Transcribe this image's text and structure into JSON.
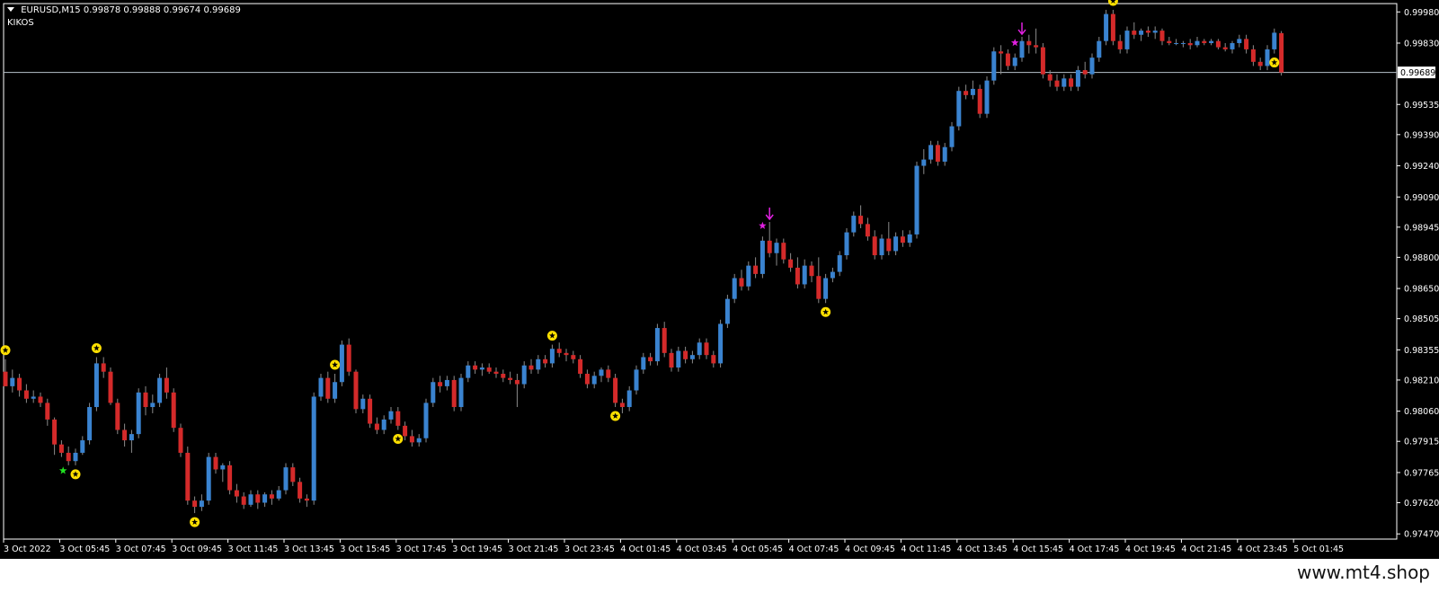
{
  "header": {
    "symbol": "EURUSD,M15",
    "ohlc": "0.99878 0.99888 0.99674 0.99689",
    "indicator": "KIKOS"
  },
  "watermark": "www.mt4.shop",
  "price_tag": "0.99689",
  "colors": {
    "background": "#000000",
    "bull": "#3a83d0",
    "bear": "#d42a2a",
    "grid_axis": "#ffffff",
    "star_signal": "#ffe000",
    "magenta_signal": "#e020e0",
    "green_signal": "#20e020",
    "price_line": "#b8c2cc"
  },
  "chart_data": {
    "type": "candlestick",
    "symbol": "EURUSD",
    "timeframe": "M15",
    "y_ticks": [
      0.9998,
      0.9983,
      0.99689,
      0.99535,
      0.9939,
      0.9924,
      0.9909,
      0.98945,
      0.988,
      0.9865,
      0.98505,
      0.98355,
      0.9821,
      0.9806,
      0.97915,
      0.97765,
      0.9762,
      0.9747
    ],
    "y_tick_labels": [
      "0.99980",
      "0.99830",
      "0.99689",
      "0.99535",
      "0.99390",
      "0.99240",
      "0.99090",
      "0.98945",
      "0.98800",
      "0.98650",
      "0.98505",
      "0.98355",
      "0.98210",
      "0.98060",
      "0.97915",
      "0.97765",
      "0.97620",
      "0.97470"
    ],
    "ylim": [
      0.97445,
      1.0002
    ],
    "x_labels": [
      "3 Oct 2022",
      "3 Oct 05:45",
      "3 Oct 07:45",
      "3 Oct 09:45",
      "3 Oct 11:45",
      "3 Oct 13:45",
      "3 Oct 15:45",
      "3 Oct 17:45",
      "3 Oct 19:45",
      "3 Oct 21:45",
      "3 Oct 23:45",
      "4 Oct 01:45",
      "4 Oct 03:45",
      "4 Oct 05:45",
      "4 Oct 07:45",
      "4 Oct 09:45",
      "4 Oct 11:45",
      "4 Oct 13:45",
      "4 Oct 15:45",
      "4 Oct 17:45",
      "4 Oct 19:45",
      "4 Oct 21:45",
      "4 Oct 23:45",
      "5 Oct 01:45"
    ],
    "candles_per_label": 8,
    "current_price": 0.99689,
    "candles": [
      [
        0.9825,
        0.9831,
        0.9818,
        0.9818
      ],
      [
        0.9818,
        0.9826,
        0.9815,
        0.9822
      ],
      [
        0.9822,
        0.9824,
        0.9813,
        0.9816
      ],
      [
        0.9816,
        0.9819,
        0.981,
        0.9812
      ],
      [
        0.9812,
        0.9816,
        0.981,
        0.9813
      ],
      [
        0.9813,
        0.9815,
        0.9808,
        0.981
      ],
      [
        0.981,
        0.9812,
        0.9799,
        0.9802
      ],
      [
        0.9802,
        0.9803,
        0.9785,
        0.979
      ],
      [
        0.979,
        0.9792,
        0.9784,
        0.9786
      ],
      [
        0.9786,
        0.9789,
        0.978,
        0.9782
      ],
      [
        0.9782,
        0.9788,
        0.978,
        0.9786
      ],
      [
        0.9786,
        0.9794,
        0.9785,
        0.9792
      ],
      [
        0.9792,
        0.981,
        0.979,
        0.9808
      ],
      [
        0.9808,
        0.9832,
        0.9806,
        0.9829
      ],
      [
        0.9829,
        0.9832,
        0.9822,
        0.9825
      ],
      [
        0.9825,
        0.9827,
        0.9809,
        0.981
      ],
      [
        0.981,
        0.9812,
        0.9795,
        0.9797
      ],
      [
        0.9797,
        0.98,
        0.9789,
        0.9792
      ],
      [
        0.9792,
        0.9797,
        0.9786,
        0.9795
      ],
      [
        0.9795,
        0.9817,
        0.9793,
        0.9815
      ],
      [
        0.9815,
        0.9818,
        0.9804,
        0.9808
      ],
      [
        0.9808,
        0.9814,
        0.9805,
        0.981
      ],
      [
        0.981,
        0.9824,
        0.9808,
        0.9822
      ],
      [
        0.9822,
        0.9827,
        0.9812,
        0.9815
      ],
      [
        0.9815,
        0.9817,
        0.9796,
        0.9798
      ],
      [
        0.9798,
        0.98,
        0.9784,
        0.9786
      ],
      [
        0.9786,
        0.9789,
        0.9761,
        0.9763
      ],
      [
        0.9763,
        0.9765,
        0.9757,
        0.976
      ],
      [
        0.976,
        0.9766,
        0.9758,
        0.9763
      ],
      [
        0.9763,
        0.9786,
        0.9761,
        0.9784
      ],
      [
        0.9784,
        0.9786,
        0.9776,
        0.9778
      ],
      [
        0.9778,
        0.9781,
        0.9772,
        0.978
      ],
      [
        0.978,
        0.9782,
        0.9766,
        0.9768
      ],
      [
        0.9768,
        0.9771,
        0.9762,
        0.9765
      ],
      [
        0.9765,
        0.9767,
        0.9759,
        0.9761
      ],
      [
        0.9761,
        0.9768,
        0.976,
        0.9766
      ],
      [
        0.9766,
        0.9768,
        0.9759,
        0.9762
      ],
      [
        0.9762,
        0.9767,
        0.976,
        0.9766
      ],
      [
        0.9766,
        0.9768,
        0.9761,
        0.9764
      ],
      [
        0.9764,
        0.977,
        0.9763,
        0.9768
      ],
      [
        0.9768,
        0.9781,
        0.9766,
        0.9779
      ],
      [
        0.9779,
        0.9781,
        0.977,
        0.9772
      ],
      [
        0.9772,
        0.9774,
        0.9762,
        0.9764
      ],
      [
        0.9764,
        0.9766,
        0.976,
        0.9763
      ],
      [
        0.9763,
        0.9815,
        0.9761,
        0.9813
      ],
      [
        0.9813,
        0.9824,
        0.9811,
        0.9822
      ],
      [
        0.9822,
        0.9825,
        0.981,
        0.9812
      ],
      [
        0.9812,
        0.9824,
        0.981,
        0.982
      ],
      [
        0.982,
        0.984,
        0.9818,
        0.9838
      ],
      [
        0.9838,
        0.9841,
        0.9823,
        0.9825
      ],
      [
        0.9825,
        0.9826,
        0.9805,
        0.9807
      ],
      [
        0.9807,
        0.9814,
        0.9805,
        0.9812
      ],
      [
        0.9812,
        0.9814,
        0.9798,
        0.98
      ],
      [
        0.98,
        0.9803,
        0.9795,
        0.9797
      ],
      [
        0.9797,
        0.9804,
        0.9795,
        0.9802
      ],
      [
        0.9802,
        0.9808,
        0.98,
        0.9806
      ],
      [
        0.9806,
        0.9808,
        0.9797,
        0.9799
      ],
      [
        0.9799,
        0.9801,
        0.9792,
        0.9794
      ],
      [
        0.9794,
        0.9797,
        0.9789,
        0.9791
      ],
      [
        0.9791,
        0.9795,
        0.9789,
        0.9793
      ],
      [
        0.9793,
        0.9812,
        0.9791,
        0.981
      ],
      [
        0.981,
        0.9822,
        0.9808,
        0.982
      ],
      [
        0.982,
        0.9823,
        0.9815,
        0.9818
      ],
      [
        0.9818,
        0.9823,
        0.9816,
        0.9821
      ],
      [
        0.9821,
        0.9823,
        0.9806,
        0.9808
      ],
      [
        0.9808,
        0.9824,
        0.9806,
        0.9822
      ],
      [
        0.9822,
        0.983,
        0.982,
        0.9828
      ],
      [
        0.9828,
        0.983,
        0.9824,
        0.9826
      ],
      [
        0.9826,
        0.9829,
        0.9823,
        0.9827
      ],
      [
        0.9827,
        0.9829,
        0.9824,
        0.9825
      ],
      [
        0.9825,
        0.9827,
        0.9822,
        0.9824
      ],
      [
        0.9824,
        0.9826,
        0.982,
        0.9822
      ],
      [
        0.9822,
        0.9825,
        0.9819,
        0.9821
      ],
      [
        0.9821,
        0.9824,
        0.9808,
        0.9819
      ],
      [
        0.9819,
        0.983,
        0.9817,
        0.9828
      ],
      [
        0.9828,
        0.9831,
        0.9824,
        0.9826
      ],
      [
        0.9826,
        0.9833,
        0.9824,
        0.9831
      ],
      [
        0.9831,
        0.9833,
        0.9827,
        0.9829
      ],
      [
        0.9829,
        0.9838,
        0.9827,
        0.9836
      ],
      [
        0.9836,
        0.9839,
        0.9832,
        0.9834
      ],
      [
        0.9834,
        0.9836,
        0.983,
        0.9833
      ],
      [
        0.9833,
        0.9835,
        0.9829,
        0.9831
      ],
      [
        0.9831,
        0.9833,
        0.9822,
        0.9824
      ],
      [
        0.9824,
        0.9826,
        0.9817,
        0.9819
      ],
      [
        0.9819,
        0.9825,
        0.9817,
        0.9823
      ],
      [
        0.9823,
        0.9827,
        0.982,
        0.9826
      ],
      [
        0.9826,
        0.9828,
        0.982,
        0.9822
      ],
      [
        0.9822,
        0.9824,
        0.9808,
        0.981
      ],
      [
        0.981,
        0.9812,
        0.9805,
        0.9808
      ],
      [
        0.9808,
        0.9818,
        0.9806,
        0.9816
      ],
      [
        0.9816,
        0.9828,
        0.9814,
        0.9826
      ],
      [
        0.9826,
        0.9834,
        0.9824,
        0.9832
      ],
      [
        0.9832,
        0.9834,
        0.9828,
        0.983
      ],
      [
        0.983,
        0.9848,
        0.9828,
        0.9846
      ],
      [
        0.9846,
        0.9849,
        0.9832,
        0.9834
      ],
      [
        0.9834,
        0.9836,
        0.9825,
        0.9827
      ],
      [
        0.9827,
        0.9837,
        0.9825,
        0.9835
      ],
      [
        0.9835,
        0.9837,
        0.9829,
        0.9831
      ],
      [
        0.9831,
        0.9835,
        0.9829,
        0.9833
      ],
      [
        0.9833,
        0.9841,
        0.9831,
        0.9839
      ],
      [
        0.9839,
        0.9841,
        0.9831,
        0.9833
      ],
      [
        0.9833,
        0.9835,
        0.9827,
        0.9829
      ],
      [
        0.9829,
        0.985,
        0.9827,
        0.9848
      ],
      [
        0.9848,
        0.9862,
        0.9846,
        0.986
      ],
      [
        0.986,
        0.9872,
        0.9858,
        0.987
      ],
      [
        0.987,
        0.9874,
        0.9864,
        0.9866
      ],
      [
        0.9866,
        0.9878,
        0.9864,
        0.9876
      ],
      [
        0.9876,
        0.988,
        0.987,
        0.9872
      ],
      [
        0.9872,
        0.989,
        0.987,
        0.9888
      ],
      [
        0.9888,
        0.9897,
        0.988,
        0.9882
      ],
      [
        0.9882,
        0.9889,
        0.9876,
        0.9887
      ],
      [
        0.9887,
        0.9889,
        0.9877,
        0.9879
      ],
      [
        0.9879,
        0.9882,
        0.9873,
        0.9875
      ],
      [
        0.9875,
        0.988,
        0.9865,
        0.9867
      ],
      [
        0.9867,
        0.9879,
        0.9865,
        0.9876
      ],
      [
        0.9876,
        0.9878,
        0.9868,
        0.9871
      ],
      [
        0.9871,
        0.988,
        0.9858,
        0.986
      ],
      [
        0.986,
        0.9872,
        0.9858,
        0.987
      ],
      [
        0.987,
        0.9875,
        0.9868,
        0.9873
      ],
      [
        0.9873,
        0.9883,
        0.9871,
        0.9881
      ],
      [
        0.9881,
        0.9894,
        0.9879,
        0.9892
      ],
      [
        0.9892,
        0.9902,
        0.989,
        0.99
      ],
      [
        0.99,
        0.9905,
        0.9894,
        0.9896
      ],
      [
        0.9896,
        0.9899,
        0.9888,
        0.989
      ],
      [
        0.989,
        0.9893,
        0.9879,
        0.9881
      ],
      [
        0.9881,
        0.9891,
        0.9879,
        0.9889
      ],
      [
        0.9889,
        0.9897,
        0.9881,
        0.9883
      ],
      [
        0.9883,
        0.9892,
        0.9881,
        0.989
      ],
      [
        0.989,
        0.9893,
        0.9885,
        0.9887
      ],
      [
        0.9887,
        0.9893,
        0.9885,
        0.9891
      ],
      [
        0.9891,
        0.9926,
        0.9889,
        0.9924
      ],
      [
        0.9924,
        0.9932,
        0.992,
        0.9927
      ],
      [
        0.9927,
        0.9936,
        0.9925,
        0.9934
      ],
      [
        0.9934,
        0.9936,
        0.9924,
        0.9926
      ],
      [
        0.9926,
        0.9935,
        0.9924,
        0.9933
      ],
      [
        0.9933,
        0.9945,
        0.9931,
        0.9943
      ],
      [
        0.9943,
        0.9962,
        0.9941,
        0.996
      ],
      [
        0.996,
        0.9963,
        0.9956,
        0.9958
      ],
      [
        0.9958,
        0.9965,
        0.9956,
        0.9961
      ],
      [
        0.9961,
        0.9963,
        0.9947,
        0.9949
      ],
      [
        0.9949,
        0.9967,
        0.9947,
        0.9965
      ],
      [
        0.9965,
        0.9981,
        0.9963,
        0.9979
      ],
      [
        0.9979,
        0.9982,
        0.9968,
        0.9978
      ],
      [
        0.9978,
        0.998,
        0.997,
        0.9972
      ],
      [
        0.9972,
        0.9978,
        0.997,
        0.9976
      ],
      [
        0.9976,
        0.9986,
        0.9974,
        0.9984
      ],
      [
        0.9984,
        0.9987,
        0.9978,
        0.9982
      ],
      [
        0.9982,
        0.999,
        0.9978,
        0.9981
      ],
      [
        0.9981,
        0.9983,
        0.9966,
        0.9968
      ],
      [
        0.9968,
        0.997,
        0.9962,
        0.9965
      ],
      [
        0.9965,
        0.9968,
        0.996,
        0.9962
      ],
      [
        0.9962,
        0.9968,
        0.996,
        0.9966
      ],
      [
        0.9966,
        0.9968,
        0.996,
        0.9962
      ],
      [
        0.9962,
        0.9972,
        0.996,
        0.997
      ],
      [
        0.997,
        0.9974,
        0.9966,
        0.9968
      ],
      [
        0.9968,
        0.9978,
        0.9966,
        0.9976
      ],
      [
        0.9976,
        0.9986,
        0.9974,
        0.9984
      ],
      [
        0.9984,
        0.9999,
        0.9982,
        0.9997
      ],
      [
        0.9997,
        0.9999,
        0.9982,
        0.9984
      ],
      [
        0.9984,
        0.9987,
        0.9978,
        0.998
      ],
      [
        0.998,
        0.9991,
        0.9978,
        0.9989
      ],
      [
        0.9989,
        0.9993,
        0.9985,
        0.9987
      ],
      [
        0.9987,
        0.999,
        0.9984,
        0.9989
      ],
      [
        0.9989,
        0.9991,
        0.9986,
        0.9988
      ],
      [
        0.9988,
        0.9991,
        0.9985,
        0.9989
      ],
      [
        0.9989,
        0.999,
        0.9982,
        0.9984
      ],
      [
        0.9984,
        0.9986,
        0.9982,
        0.9983
      ],
      [
        0.9983,
        0.9985,
        0.9982,
        0.9983
      ],
      [
        0.9983,
        0.9984,
        0.9981,
        0.9983
      ],
      [
        0.9983,
        0.9985,
        0.998,
        0.9982
      ],
      [
        0.9982,
        0.9986,
        0.9981,
        0.9984
      ],
      [
        0.9984,
        0.9985,
        0.9982,
        0.9983
      ],
      [
        0.9983,
        0.9985,
        0.9982,
        0.9984
      ],
      [
        0.9984,
        0.9985,
        0.998,
        0.9981
      ],
      [
        0.9981,
        0.9983,
        0.9979,
        0.998
      ],
      [
        0.998,
        0.9984,
        0.9978,
        0.9983
      ],
      [
        0.9983,
        0.9987,
        0.9981,
        0.9985
      ],
      [
        0.9985,
        0.9987,
        0.9978,
        0.998
      ],
      [
        0.998,
        0.9982,
        0.9972,
        0.9974
      ],
      [
        0.9974,
        0.9976,
        0.997,
        0.9972
      ],
      [
        0.9972,
        0.9982,
        0.997,
        0.998
      ],
      [
        0.998,
        0.999,
        0.9978,
        0.9988
      ],
      [
        0.99878,
        0.99888,
        0.99674,
        0.99689
      ]
    ],
    "markers": [
      {
        "index": 0,
        "type": "star-circle",
        "at": "high"
      },
      {
        "index": 10,
        "type": "star-circle",
        "at": "low"
      },
      {
        "index": 13,
        "type": "star-circle",
        "at": "high"
      },
      {
        "index": 27,
        "type": "star-circle",
        "at": "low"
      },
      {
        "index": 47,
        "type": "star-circle",
        "at": "high"
      },
      {
        "index": 56,
        "type": "star-circle",
        "at": "low"
      },
      {
        "index": 78,
        "type": "star-circle",
        "at": "high"
      },
      {
        "index": 87,
        "type": "star-circle",
        "at": "low"
      },
      {
        "index": 117,
        "type": "star-circle",
        "at": "low"
      },
      {
        "index": 158,
        "type": "star-circle",
        "at": "high"
      },
      {
        "index": 181,
        "type": "star-circle",
        "at": "low"
      },
      {
        "index": 185,
        "type": "star-circle",
        "at": "low"
      },
      {
        "index": 108,
        "type": "magenta-star",
        "at": "high"
      },
      {
        "index": 109,
        "type": "magenta-arrow-down",
        "at": "high"
      },
      {
        "index": 144,
        "type": "magenta-star",
        "at": "high"
      },
      {
        "index": 145,
        "type": "magenta-arrow-down",
        "at": "high"
      },
      {
        "index": 9,
        "type": "green-star",
        "at": "low"
      }
    ]
  }
}
